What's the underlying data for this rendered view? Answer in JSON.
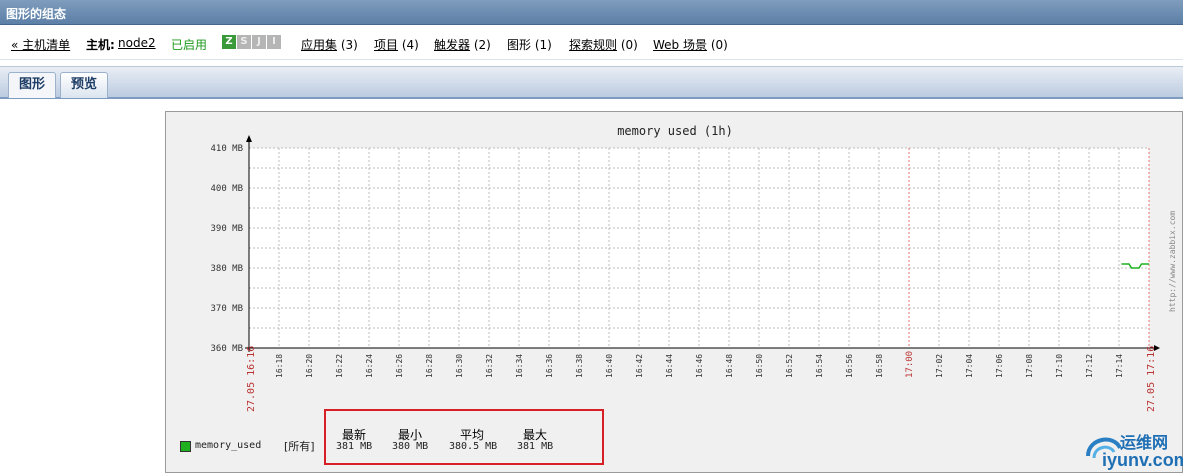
{
  "page": {
    "title": "图形的组态"
  },
  "nav": {
    "host_list_link": "« 主机清单",
    "host_label": "主机:",
    "host_name": "node2",
    "host_status": "已启用",
    "badges": [
      "Z",
      "S",
      "J",
      "I"
    ],
    "links": [
      {
        "label": "应用集",
        "count": "(3)"
      },
      {
        "label": "项目",
        "count": "(4)"
      },
      {
        "label": "触发器",
        "count": "(2)"
      },
      {
        "label": "图形",
        "count": "(1)"
      },
      {
        "label": "探索规则",
        "count": "(0)"
      },
      {
        "label": "Web 场景",
        "count": "(0)"
      }
    ]
  },
  "tabs": [
    {
      "label": "图形"
    },
    {
      "label": "预览"
    }
  ],
  "graph": {
    "watermark": "http://www.zabbix.com",
    "legend": {
      "item_name": "memory_used",
      "func": "[所有]",
      "stat_headers": [
        "最新",
        "最小",
        "平均",
        "最大"
      ],
      "stat_values": [
        "381 MB",
        "380 MB",
        "380.5 MB",
        "381 MB"
      ]
    }
  },
  "chart_data": {
    "type": "line",
    "title": "memory used (1h)",
    "y_ticks": [
      "410 MB",
      "400 MB",
      "390 MB",
      "380 MB",
      "370 MB",
      "360 MB"
    ],
    "ylim": [
      360,
      410
    ],
    "x_ticks": [
      "16:18",
      "16:20",
      "16:22",
      "16:24",
      "16:26",
      "16:28",
      "16:30",
      "16:32",
      "16:34",
      "16:36",
      "16:38",
      "16:40",
      "16:42",
      "16:44",
      "16:46",
      "16:48",
      "16:50",
      "16:52",
      "16:54",
      "16:56",
      "16:58",
      "17:00",
      "17:02",
      "17:04",
      "17:06",
      "17:08",
      "17:10",
      "17:12",
      "17:14"
    ],
    "x_start_label": "27.05 16:16",
    "x_end_label": "27.05 17:16",
    "highlight_tick": "17:00",
    "series": [
      {
        "name": "memory_used",
        "color": "#1eb01e",
        "x": [
          "17:14:10",
          "17:14:40",
          "17:14:50",
          "17:15:20",
          "17:15:30",
          "17:16:00"
        ],
        "values": [
          381,
          381,
          380,
          380,
          381,
          381
        ]
      }
    ]
  },
  "logo": {
    "top": "运维网",
    "bottom": "iyunv.com"
  }
}
